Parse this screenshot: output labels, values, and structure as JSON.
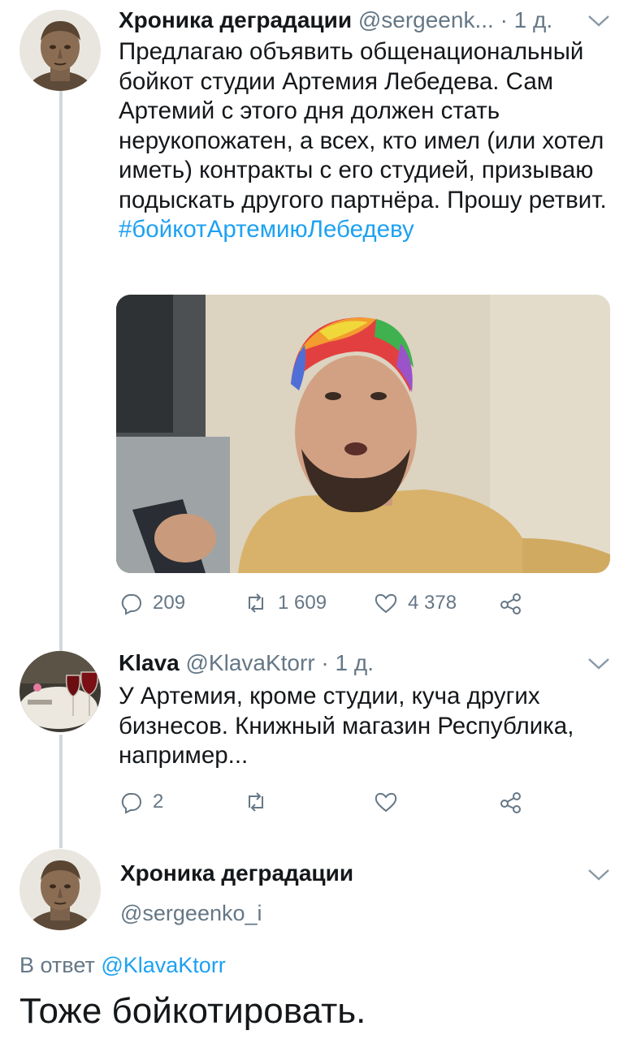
{
  "tweet1": {
    "author_name": "Хроника деградации",
    "author_handle": "@sergeenk...",
    "time": "· 1 д.",
    "text": "Предлагаю объявить общенациональный бойкот студии Артемия Лебедева. Сам Артемий с этого дня должен стать нерукопожатен, а всех, кто имел (или хотел иметь) контракты с его студией, призываю подыскать другого партнёра. Прошу ретвит.",
    "hashtag": "#бойкотАртемиюЛебедеву",
    "replies": "209",
    "retweets": "1 609",
    "likes": "4 378"
  },
  "tweet2": {
    "author_name": "Klava",
    "author_handle": "@KlavaKtorr",
    "time": "· 1 д.",
    "text": "У Артемия, кроме студии, куча других бизнесов. Книжный магазин Республика, например...",
    "replies": "2",
    "retweets": "",
    "likes": ""
  },
  "tweet3": {
    "author_name": "Хроника деградации",
    "author_handle": "@sergeenko_i",
    "reply_prefix": "В ответ",
    "reply_mention": "@KlavaKtorr",
    "text": "Тоже бойкотировать."
  },
  "colors": {
    "accent": "#1da1f2",
    "muted": "#657786",
    "thread_line": "#cfd9de"
  },
  "icons": [
    "reply-icon",
    "retweet-icon",
    "like-icon",
    "share-icon",
    "chevron-down-icon"
  ]
}
